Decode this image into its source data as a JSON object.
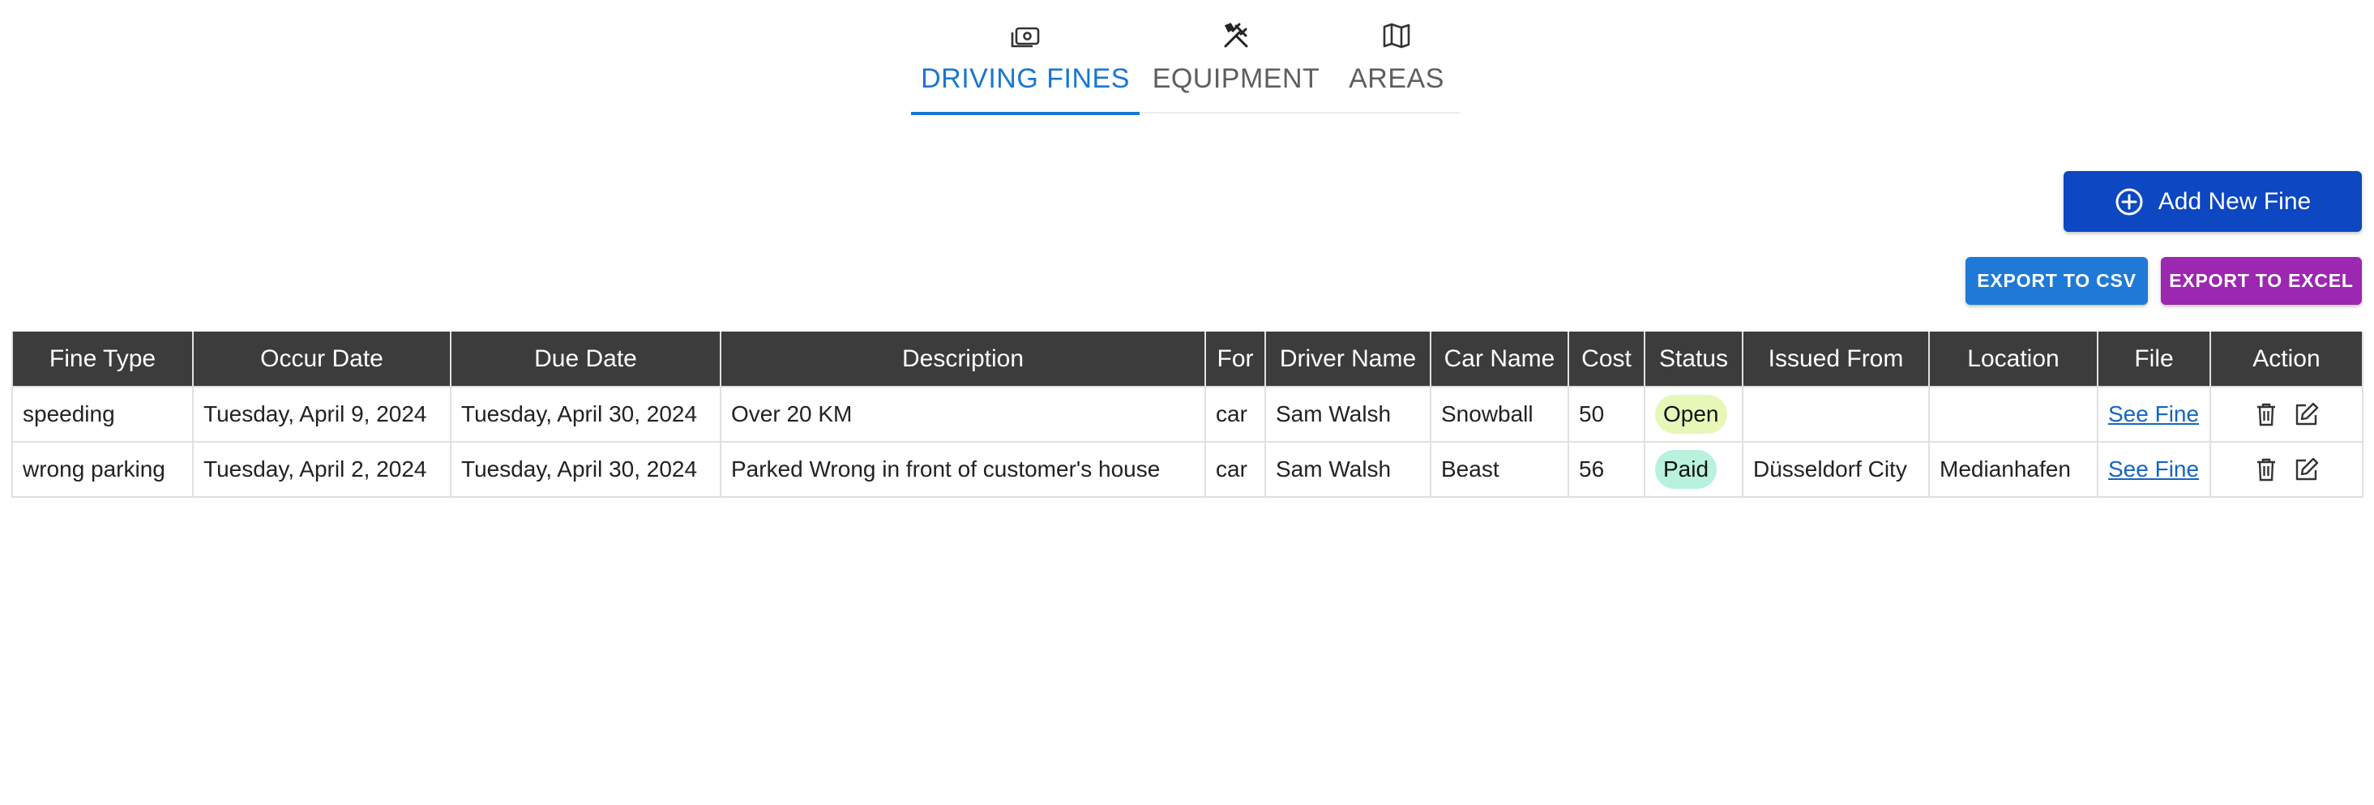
{
  "tabs": [
    {
      "label": "DRIVING FINES",
      "icon": "money-icon",
      "active": true
    },
    {
      "label": "EQUIPMENT",
      "icon": "tools-icon",
      "active": false
    },
    {
      "label": "AREAS",
      "icon": "map-icon",
      "active": false
    }
  ],
  "toolbar": {
    "add_label": "Add New Fine",
    "export_csv_label": "EXPORT TO CSV",
    "export_excel_label": "EXPORT TO EXCEL"
  },
  "table": {
    "headers": [
      "Fine Type",
      "Occur Date",
      "Due Date",
      "Description",
      "For",
      "Driver Name",
      "Car Name",
      "Cost",
      "Status",
      "Issued From",
      "Location",
      "File",
      "Action"
    ],
    "rows": [
      {
        "fine_type": "speeding",
        "occur_date": "Tuesday, April 9, 2024",
        "due_date": "Tuesday, April 30, 2024",
        "description": "Over 20 KM",
        "for": "car",
        "driver_name": "Sam Walsh",
        "car_name": "Snowball",
        "cost": "50",
        "status": "Open",
        "issued_from": "",
        "location": "",
        "file": "See Fine"
      },
      {
        "fine_type": "wrong parking",
        "occur_date": "Tuesday, April 2, 2024",
        "due_date": "Tuesday, April 30, 2024",
        "description": "Parked Wrong in front of customer's house",
        "for": "car",
        "driver_name": "Sam Walsh",
        "car_name": "Beast",
        "cost": "56",
        "status": "Paid",
        "issued_from": "Düsseldorf City",
        "location": "Medianhafen",
        "file": "See Fine"
      }
    ]
  },
  "colors": {
    "accent": "#1976d2",
    "add_button": "#0d47c1",
    "export_csv": "#1e7ad6",
    "export_excel": "#9c27b0",
    "header_bg": "#3c3c3c",
    "status_open": "#e6f7b8",
    "status_paid": "#b8f2dc"
  }
}
